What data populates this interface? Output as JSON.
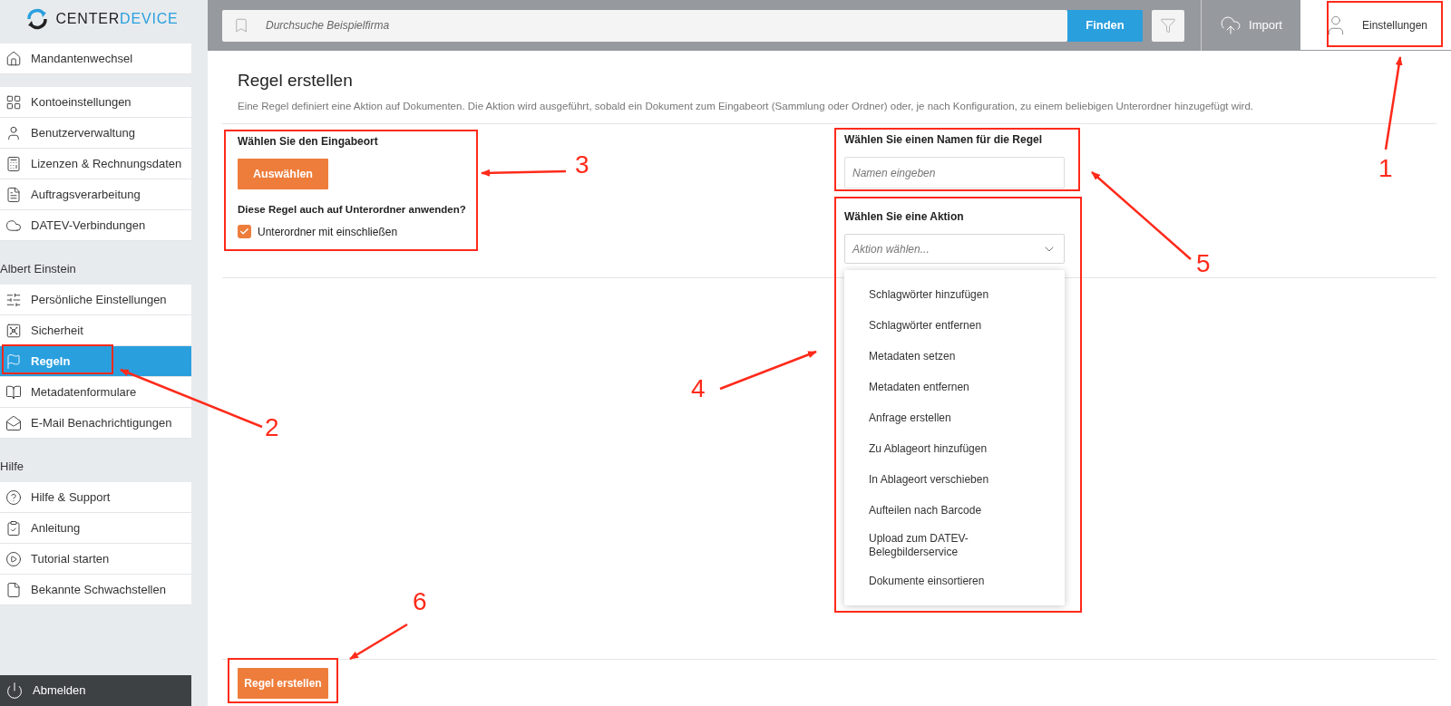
{
  "logo": {
    "first": "CENTER",
    "second": "DEVICE"
  },
  "sidebar": {
    "groups": [
      {
        "items": [
          {
            "label": "Mandantenwechsel",
            "selected": false
          }
        ]
      },
      {
        "items": [
          {
            "label": "Kontoeinstellungen",
            "selected": false
          },
          {
            "label": "Benutzerverwaltung",
            "selected": false
          },
          {
            "label": "Lizenzen & Rechnungsdaten",
            "selected": false
          },
          {
            "label": "Auftragsverarbeitung",
            "selected": false
          },
          {
            "label": "DATEV-Verbindungen",
            "selected": false
          }
        ]
      },
      {
        "heading": "Albert Einstein",
        "items": [
          {
            "label": "Persönliche Einstellungen",
            "selected": false
          },
          {
            "label": "Sicherheit",
            "selected": false
          },
          {
            "label": "Regeln",
            "selected": true
          },
          {
            "label": "Metadatenformulare",
            "selected": false
          },
          {
            "label": "E-Mail Benachrichtigungen",
            "selected": false
          }
        ]
      },
      {
        "heading": "Hilfe",
        "items": [
          {
            "label": "Hilfe & Support",
            "selected": false
          },
          {
            "label": "Anleitung",
            "selected": false
          },
          {
            "label": "Tutorial starten",
            "selected": false
          },
          {
            "label": "Bekannte Schwachstellen",
            "selected": false
          }
        ]
      }
    ],
    "logout": "Abmelden"
  },
  "top_bar": {
    "search": {
      "placeholder": "Durchsuche Beispielfirma"
    },
    "find_button": "Finden",
    "import_button": "Import",
    "settings_button": "Einstellungen"
  },
  "form": {
    "title": "Regel erstellen",
    "description": "Eine Regel definiert eine Aktion auf Dokumenten. Die Aktion wird ausgeführt, sobald ein Dokument zum Eingabeort (Sammlung oder Ordner) oder, je nach Konfiguration, zu einem beliebigen Unterordner hinzugefügt wird.",
    "location": {
      "label": "Wählen Sie den Eingabeort",
      "button": "Auswählen",
      "subfolder_question": "Diese Regel auch auf Unterordner anwenden?",
      "checkbox": {
        "label": "Unterordner mit einschließen",
        "checked": true
      }
    },
    "name": {
      "label": "Wählen Sie einen Namen für die Regel",
      "placeholder": "Namen eingeben"
    },
    "action": {
      "label": "Wählen Sie eine Aktion",
      "placeholder": "Aktion wählen...",
      "expanded": true,
      "options": [
        "Schlagwörter hinzufügen",
        "Schlagwörter entfernen",
        "Metadaten setzen",
        "Metadaten entfernen",
        "Anfrage erstellen",
        "Zu Ablageort hinzufügen",
        "In Ablageort verschieben",
        "Aufteilen nach Barcode",
        "Upload zum DATEV-Belegbilderservice",
        "Dokumente einsortieren"
      ]
    },
    "submit": "Regel erstellen"
  },
  "annotations": [
    "1",
    "2",
    "3",
    "4",
    "5",
    "6"
  ]
}
